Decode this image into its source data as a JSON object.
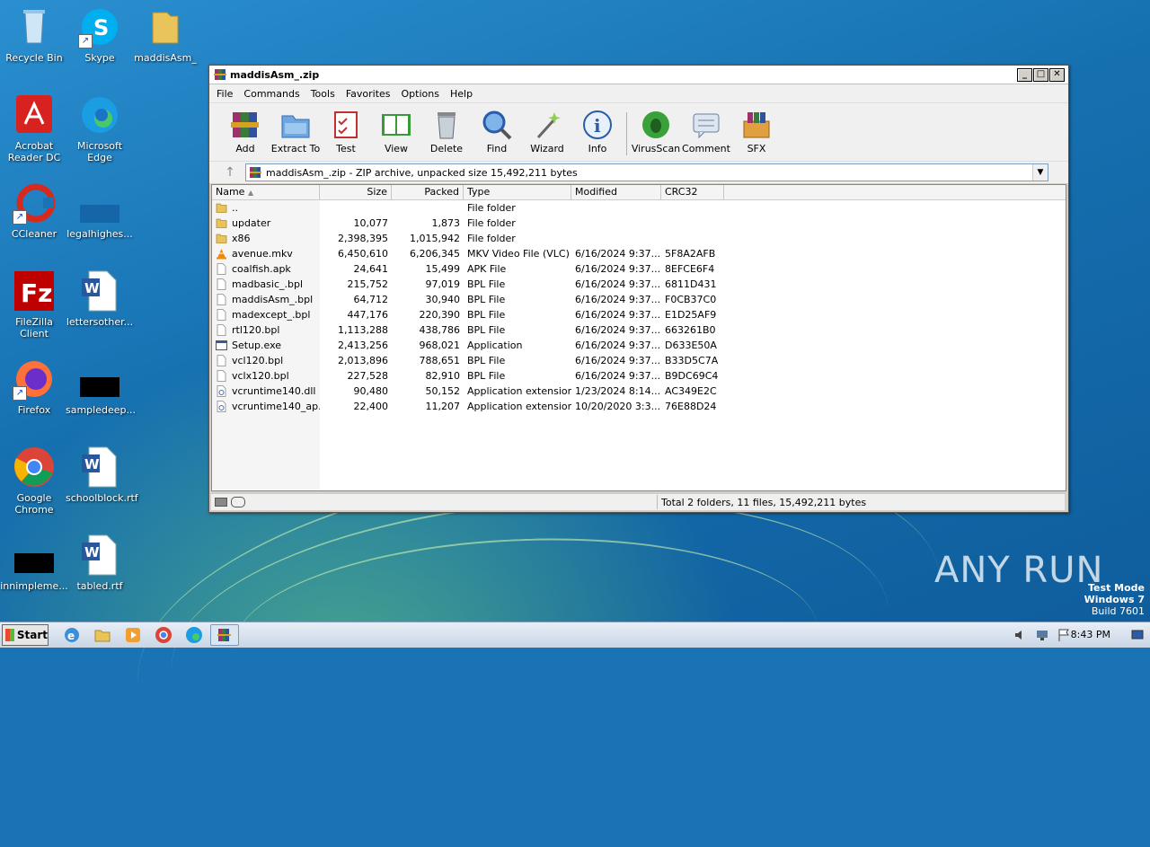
{
  "desktop": {
    "icons": [
      {
        "label": "Recycle Bin"
      },
      {
        "label": "Skype"
      },
      {
        "label": "maddisAsm_"
      },
      {
        "label": "Acrobat Reader DC"
      },
      {
        "label": "Microsoft Edge"
      },
      {
        "label": "CCleaner"
      },
      {
        "label": "legalhighes..."
      },
      {
        "label": "FileZilla Client"
      },
      {
        "label": "lettersother..."
      },
      {
        "label": "Firefox"
      },
      {
        "label": "sampledeep..."
      },
      {
        "label": "Google Chrome"
      },
      {
        "label": "schoolblock.rtf"
      },
      {
        "label": "innimpleme..."
      },
      {
        "label": "tabled.rtf"
      }
    ]
  },
  "window": {
    "title": "maddisAsm_.zip",
    "menu": [
      "File",
      "Commands",
      "Tools",
      "Favorites",
      "Options",
      "Help"
    ],
    "toolbar": [
      "Add",
      "Extract To",
      "Test",
      "View",
      "Delete",
      "Find",
      "Wizard",
      "Info",
      "VirusScan",
      "Comment",
      "SFX"
    ],
    "address": "maddisAsm_.zip - ZIP archive, unpacked size 15,492,211 bytes",
    "columns": [
      "Name",
      "Size",
      "Packed",
      "Type",
      "Modified",
      "CRC32"
    ],
    "files": [
      {
        "name": "..",
        "size": "",
        "packed": "",
        "type": "File folder",
        "modified": "",
        "crc": "",
        "icon": "folder-icon"
      },
      {
        "name": "updater",
        "size": "10,077",
        "packed": "1,873",
        "type": "File folder",
        "modified": "",
        "crc": "",
        "icon": "folder-icon"
      },
      {
        "name": "x86",
        "size": "2,398,395",
        "packed": "1,015,942",
        "type": "File folder",
        "modified": "",
        "crc": "",
        "icon": "folder-icon"
      },
      {
        "name": "avenue.mkv",
        "size": "6,450,610",
        "packed": "6,206,345",
        "type": "MKV Video File (VLC)",
        "modified": "6/16/2024 9:37...",
        "crc": "5F8A2AFB",
        "icon": "vlc-icon"
      },
      {
        "name": "coalfish.apk",
        "size": "24,641",
        "packed": "15,499",
        "type": "APK File",
        "modified": "6/16/2024 9:37...",
        "crc": "8EFCE6F4",
        "icon": "file-icon"
      },
      {
        "name": "madbasic_.bpl",
        "size": "215,752",
        "packed": "97,019",
        "type": "BPL File",
        "modified": "6/16/2024 9:37...",
        "crc": "6811D431",
        "icon": "file-icon"
      },
      {
        "name": "maddisAsm_.bpl",
        "size": "64,712",
        "packed": "30,940",
        "type": "BPL File",
        "modified": "6/16/2024 9:37...",
        "crc": "F0CB37C0",
        "icon": "file-icon"
      },
      {
        "name": "madexcept_.bpl",
        "size": "447,176",
        "packed": "220,390",
        "type": "BPL File",
        "modified": "6/16/2024 9:37...",
        "crc": "E1D25AF9",
        "icon": "file-icon"
      },
      {
        "name": "rtl120.bpl",
        "size": "1,113,288",
        "packed": "438,786",
        "type": "BPL File",
        "modified": "6/16/2024 9:37...",
        "crc": "663261B0",
        "icon": "file-icon"
      },
      {
        "name": "Setup.exe",
        "size": "2,413,256",
        "packed": "968,021",
        "type": "Application",
        "modified": "6/16/2024 9:37...",
        "crc": "D633E50A",
        "icon": "exe-icon"
      },
      {
        "name": "vcl120.bpl",
        "size": "2,013,896",
        "packed": "788,651",
        "type": "BPL File",
        "modified": "6/16/2024 9:37...",
        "crc": "B33D5C7A",
        "icon": "file-icon"
      },
      {
        "name": "vclx120.bpl",
        "size": "227,528",
        "packed": "82,910",
        "type": "BPL File",
        "modified": "6/16/2024 9:37...",
        "crc": "B9DC69C4",
        "icon": "file-icon"
      },
      {
        "name": "vcruntime140.dll",
        "size": "90,480",
        "packed": "50,152",
        "type": "Application extension",
        "modified": "1/23/2024 8:14...",
        "crc": "AC349E2C",
        "icon": "dll-icon"
      },
      {
        "name": "vcruntime140_ap...",
        "size": "22,400",
        "packed": "11,207",
        "type": "Application extension",
        "modified": "10/20/2020 3:3...",
        "crc": "76E88D24",
        "icon": "dll-icon"
      }
    ],
    "status": "Total 2 folders, 11 files, 15,492,211 bytes"
  },
  "taskbar": {
    "start": "Start",
    "time": "8:43 PM"
  },
  "watermark": "ANY RUN",
  "testmode": [
    "Test Mode",
    "Windows 7",
    "Build 7601"
  ]
}
